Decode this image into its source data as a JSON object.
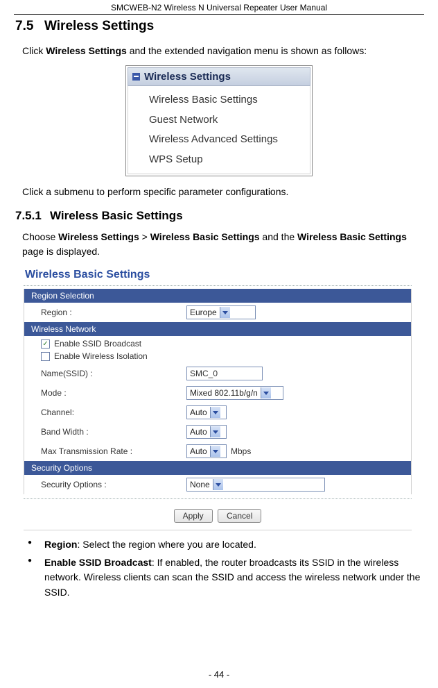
{
  "header": "SMCWEB-N2 Wireless N Universal Repeater User Manual",
  "section": {
    "num": "7.5",
    "title": "Wireless Settings"
  },
  "p1_a": "Click ",
  "p1_b": "Wireless Settings",
  "p1_c": " and the extended navigation menu is shown as follows:",
  "nav": {
    "title": "Wireless Settings",
    "items": [
      "Wireless Basic Settings",
      "Guest Network",
      "Wireless Advanced Settings",
      "WPS Setup"
    ]
  },
  "p2": "Click a submenu to perform specific parameter configurations.",
  "subsection": {
    "num": "7.5.1",
    "title": "Wireless Basic Settings"
  },
  "p3_a": "Choose ",
  "p3_b": "Wireless Settings",
  "p3_c": " > ",
  "p3_d": "Wireless Basic Settings",
  "p3_e": " and the ",
  "p3_f": "Wireless Basic Settings",
  "p3_g": " page is displayed.",
  "panel": {
    "title": "Wireless Basic Settings",
    "grp_region": "Region Selection",
    "region_label": "Region :",
    "region_value": "Europe",
    "grp_wireless": "Wireless Network",
    "chk1": "Enable SSID Broadcast",
    "chk2": "Enable Wireless Isolation",
    "name_label": "Name(SSID) :",
    "name_value": "SMC_0",
    "mode_label": "Mode :",
    "mode_value": "Mixed 802.11b/g/n",
    "channel_label": "Channel:",
    "channel_value": "Auto",
    "bw_label": "Band Width :",
    "bw_value": "Auto",
    "rate_label": "Max Transmission Rate :",
    "rate_value": "Auto",
    "rate_unit": "Mbps",
    "grp_security": "Security Options",
    "sec_label": "Security Options :",
    "sec_value": "None",
    "btn_apply": "Apply",
    "btn_cancel": "Cancel"
  },
  "bullets": {
    "b1_term": "Region",
    "b1_text": ": Select the region where you are located.",
    "b2_term": "Enable SSID Broadcast",
    "b2_text": ": If enabled, the router broadcasts its SSID in the wireless network. Wireless clients can scan the SSID and access the wireless network under the SSID."
  },
  "page_number": "- 44 -"
}
